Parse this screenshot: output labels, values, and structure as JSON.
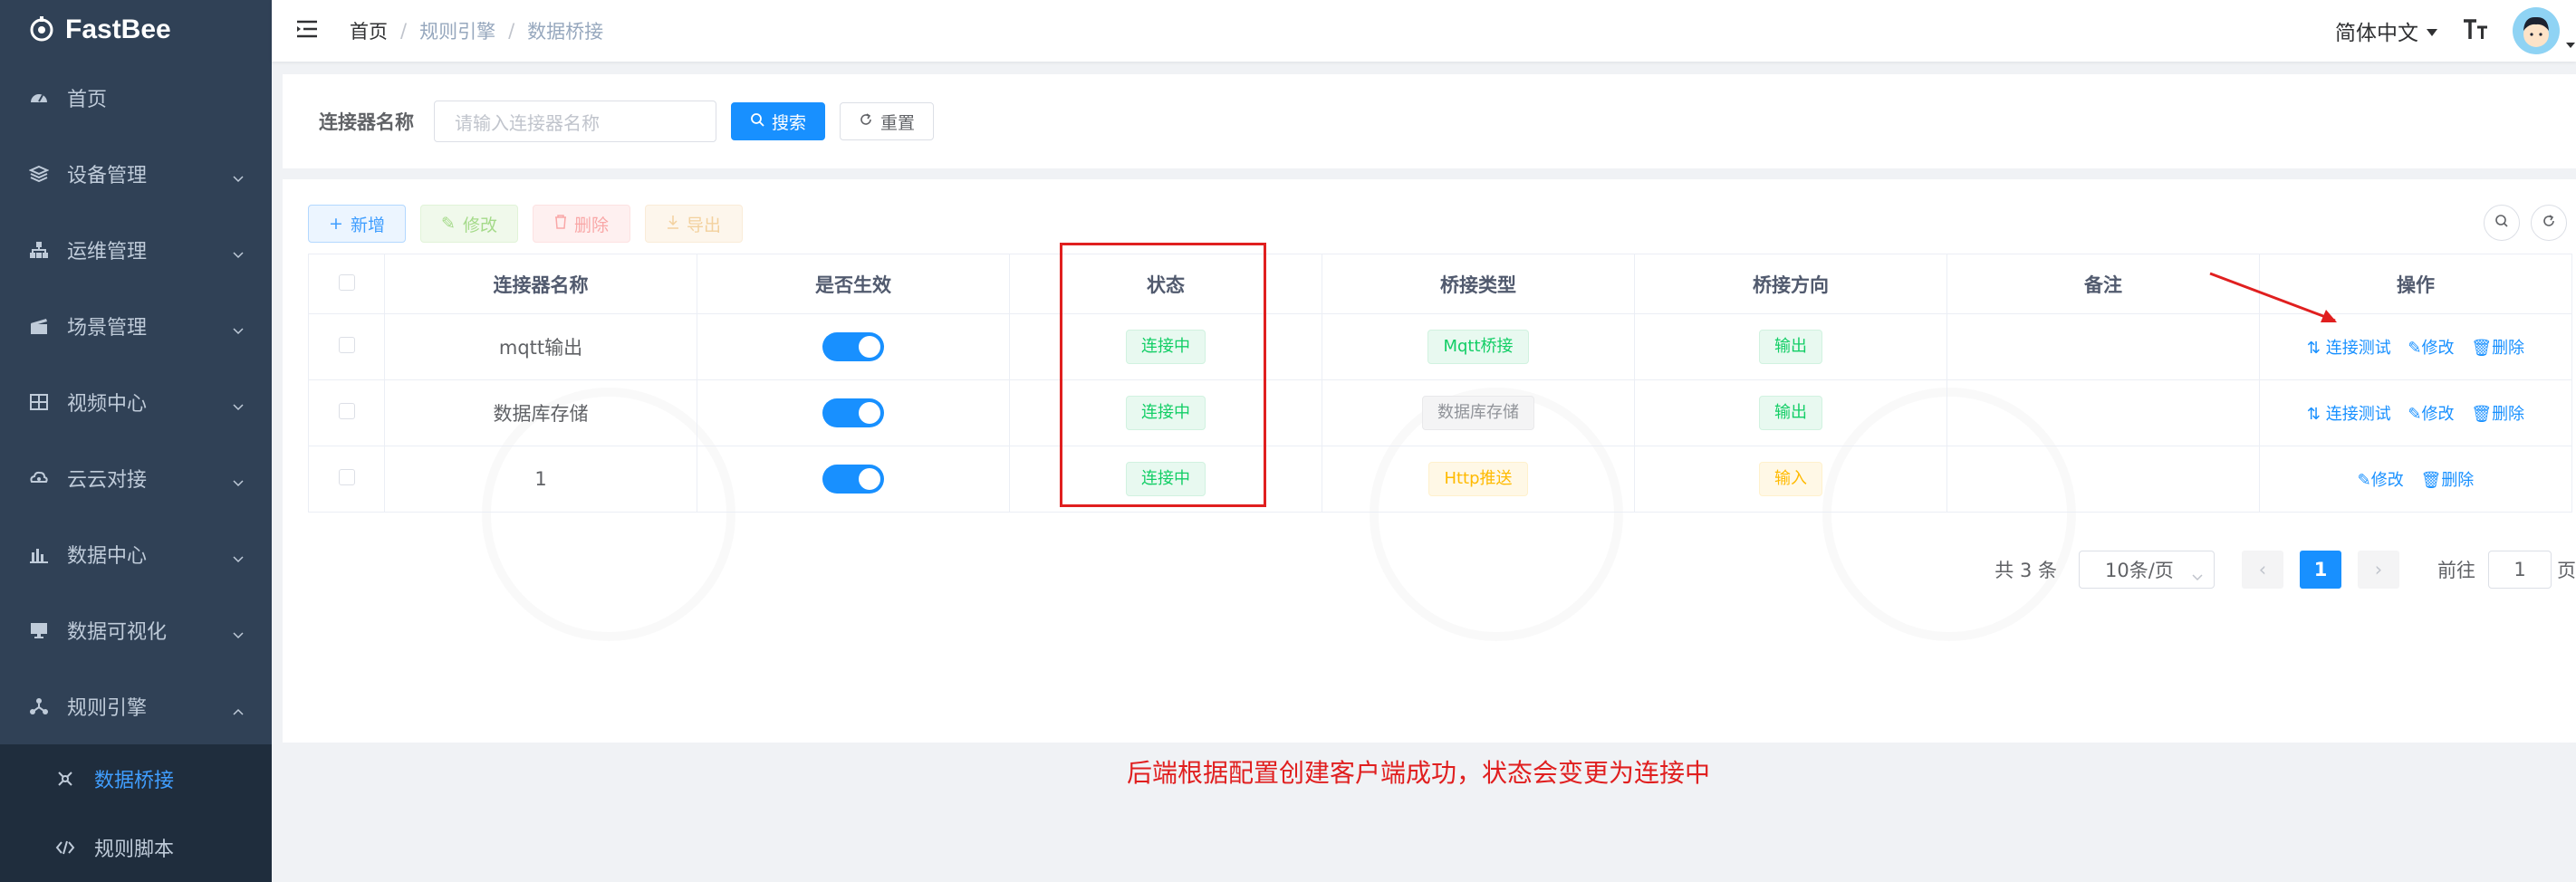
{
  "app": {
    "logo_text": "FastBee"
  },
  "sidebar": {
    "items": [
      {
        "label": "首页",
        "icon": "dashboard-icon"
      },
      {
        "label": "设备管理",
        "icon": "layers-icon"
      },
      {
        "label": "运维管理",
        "icon": "tree-icon"
      },
      {
        "label": "场景管理",
        "icon": "clapper-icon"
      },
      {
        "label": "视频中心",
        "icon": "grid-icon"
      },
      {
        "label": "云云对接",
        "icon": "cloud-icon"
      },
      {
        "label": "数据中心",
        "icon": "bar-chart-icon"
      },
      {
        "label": "数据可视化",
        "icon": "monitor-icon"
      },
      {
        "label": "规则引擎",
        "icon": "nodes-icon"
      }
    ],
    "sub_items": [
      {
        "label": "数据桥接",
        "icon": "bridge-icon",
        "active": true
      },
      {
        "label": "规则脚本",
        "icon": "code-icon"
      }
    ]
  },
  "header": {
    "breadcrumb": [
      "首页",
      "规则引擎",
      "数据桥接"
    ],
    "language": "简体中文"
  },
  "search": {
    "label": "连接器名称",
    "placeholder": "请输入连接器名称",
    "search_button": "搜索",
    "reset_button": "重置"
  },
  "toolbar": {
    "add": "新增",
    "edit": "修改",
    "delete": "删除",
    "export": "导出"
  },
  "table": {
    "columns": [
      "连接器名称",
      "是否生效",
      "状态",
      "桥接类型",
      "桥接方向",
      "备注",
      "操作"
    ],
    "rows": [
      {
        "name": "mqtt输出",
        "enabled": true,
        "status": "连接中",
        "bridge_type": "Mqtt桥接",
        "direction": "输出",
        "remark": "",
        "ops": [
          "连接测试",
          "修改",
          "删除"
        ]
      },
      {
        "name": "数据库存储",
        "enabled": true,
        "status": "连接中",
        "bridge_type": "数据库存储",
        "direction": "输出",
        "remark": "",
        "ops": [
          "连接测试",
          "修改",
          "删除"
        ]
      },
      {
        "name": "1",
        "enabled": true,
        "status": "连接中",
        "bridge_type": "Http推送",
        "direction": "输入",
        "remark": "",
        "ops": [
          "修改",
          "删除"
        ]
      }
    ]
  },
  "pagination": {
    "total": "共 3 条",
    "page_size": "10条/页",
    "current": "1",
    "goto_prefix": "前往",
    "goto_value": "1",
    "goto_suffix": "页"
  },
  "annotation": "后端根据配置创建客户端成功，状态会变更为连接中",
  "colors": {
    "primary": "#1890ff",
    "sidebar_bg": "#304156",
    "annotation": "#e01f1f",
    "success": "#13ce66",
    "warning": "#ffba00"
  }
}
